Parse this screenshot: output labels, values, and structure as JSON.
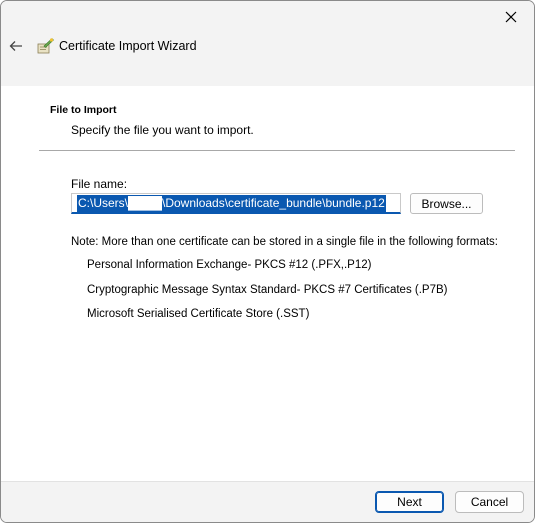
{
  "window": {
    "title": "Certificate Import Wizard",
    "close_icon": "close-icon",
    "back_icon": "back-arrow-icon",
    "wizard_icon": "certificate-wizard-icon"
  },
  "section": {
    "title": "File to Import",
    "subtitle": "Specify the file you want to import."
  },
  "file": {
    "label": "File name:",
    "value": "C:\\Users\\████\\Downloads\\certificate_bundle\\bundle.p12",
    "browse_label": "Browse..."
  },
  "note": {
    "text": "Note:  More than one certificate can be stored in a single file in the following formats:",
    "formats": [
      "Personal Information Exchange- PKCS #12 (.PFX,.P12)",
      "Cryptographic Message Syntax Standard- PKCS #7 Certificates (.P7B)",
      "Microsoft Serialised Certificate Store (.SST)"
    ]
  },
  "footer": {
    "next_label": "Next",
    "cancel_label": "Cancel"
  },
  "colors": {
    "accent": "#0a58b0",
    "header_bg": "#f3f3f3"
  }
}
